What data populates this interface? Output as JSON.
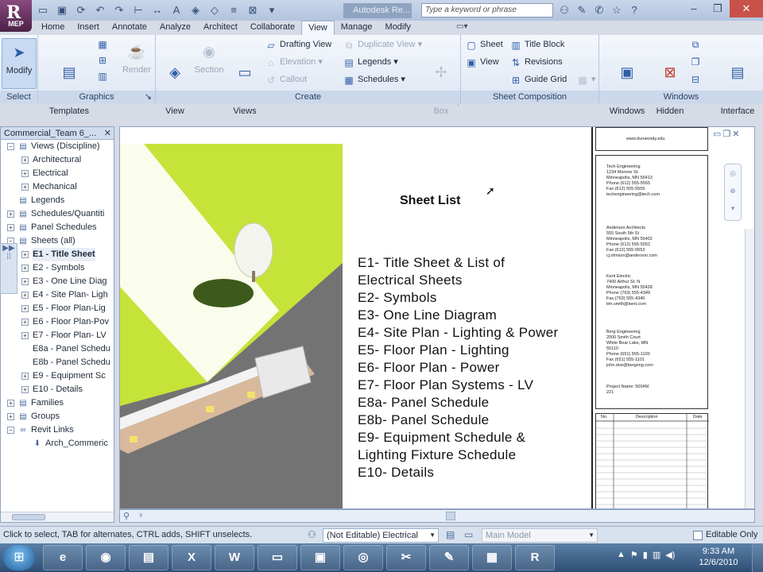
{
  "app": {
    "badge": "MEP",
    "title": "Autodesk Re...",
    "search_placeholder": "Type a keyword or phrase"
  },
  "tabs": [
    "Home",
    "Insert",
    "Annotate",
    "Analyze",
    "Architect",
    "Collaborate",
    "View",
    "Manage",
    "Modify"
  ],
  "active_tab": "View",
  "ribbon": {
    "select": {
      "label": "Select",
      "modify": "Modify"
    },
    "graphics": {
      "label": "Graphics",
      "view_templates": "View\nTemplates",
      "render": "Render"
    },
    "create": {
      "label": "Create",
      "view_3d": "3D\nView",
      "section": "Section",
      "plan_views": "Plan\nViews",
      "drafting_view": "Drafting View",
      "elevation": "Elevation",
      "callout": "Callout",
      "duplicate_view": "Duplicate View",
      "legends": "Legends",
      "schedules": "Schedules",
      "scope_box": "Scope\nBox"
    },
    "sheet_composition": {
      "label": "Sheet Composition",
      "sheet": "Sheet",
      "view": "View",
      "title_block": "Title Block",
      "revisions": "Revisions",
      "guide_grid": "Guide Grid"
    },
    "windows": {
      "label": "Windows",
      "switch_windows": "Switch\nWindows",
      "close_hidden": "Close\nHidden",
      "user_interface": "User\nInterface"
    }
  },
  "browser": {
    "title": "Commercial_Team 6_...",
    "items": [
      {
        "label": "Views (Discipline)",
        "level": 0,
        "toggle": "−",
        "icon": "views-icon"
      },
      {
        "label": "Architectural",
        "level": 1,
        "toggle": "+"
      },
      {
        "label": "Electrical",
        "level": 1,
        "toggle": "+"
      },
      {
        "label": "Mechanical",
        "level": 1,
        "toggle": "+"
      },
      {
        "label": "Legends",
        "level": 0,
        "toggle": "",
        "icon": "legends-icon"
      },
      {
        "label": "Schedules/Quantiti",
        "level": 0,
        "toggle": "+",
        "icon": "schedules-icon"
      },
      {
        "label": "Panel Schedules",
        "level": 0,
        "toggle": "+",
        "icon": "panel-schedules-icon"
      },
      {
        "label": "Sheets (all)",
        "level": 0,
        "toggle": "−",
        "icon": "sheets-icon"
      },
      {
        "label": "E1 - Title Sheet",
        "level": 1,
        "toggle": "+",
        "selected": true
      },
      {
        "label": "E2 - Symbols",
        "level": 1,
        "toggle": "+"
      },
      {
        "label": "E3 - One Line Diag",
        "level": 1,
        "toggle": "+"
      },
      {
        "label": "E4 - Site Plan- Ligh",
        "level": 1,
        "toggle": "+"
      },
      {
        "label": "E5 - Floor Plan-Lig",
        "level": 1,
        "toggle": "+"
      },
      {
        "label": "E6 - Floor Plan-Pov",
        "level": 1,
        "toggle": "+"
      },
      {
        "label": "E7 - Floor Plan- LV",
        "level": 1,
        "toggle": "+"
      },
      {
        "label": "E8a - Panel Schedu",
        "level": 1,
        "toggle": ""
      },
      {
        "label": "E8b - Panel Schedu",
        "level": 1,
        "toggle": ""
      },
      {
        "label": "E9 - Equipment Sc",
        "level": 1,
        "toggle": "+"
      },
      {
        "label": "E10 - Details",
        "level": 1,
        "toggle": "+"
      },
      {
        "label": "Families",
        "level": 0,
        "toggle": "+",
        "icon": "families-icon"
      },
      {
        "label": "Groups",
        "level": 0,
        "toggle": "+",
        "icon": "groups-icon"
      },
      {
        "label": "Revit Links",
        "level": 0,
        "toggle": "−",
        "icon": "revit-links-icon"
      },
      {
        "label": "Arch_Commeric",
        "level": 1,
        "toggle": "",
        "icon": "link-icon"
      }
    ]
  },
  "sheet": {
    "title": "Sheet List",
    "entries": [
      "E1- Title Sheet & List of",
      "Electrical Sheets",
      "E2- Symbols",
      "E3- One Line Diagram",
      "E4- Site Plan - Lighting & Power",
      "E5- Floor Plan - Lighting",
      "E6- Floor Plan - Power",
      "E7- Floor Plan Systems - LV",
      "E8a- Panel Schedule",
      "E8b- Panel Schedule",
      "E9- Equipment Schedule &",
      "Lighting Fixture Schedule",
      "E10- Details"
    ],
    "titleblock": {
      "website": "www.dunwoody.edu",
      "contacts": [
        "Tech Engineering\n1234 Monroe St.\nMinneapolis, MN 55413\nPhone (612) 555-5555\nFax (612) 555-5559\ntechengineering@tech.com",
        "Anderson Architects\n555 South 5th St\nMinneapolis, MN 55402\nPhone (612) 555-5552\nFax (612) 555-5553\ncj.ohnson@anderson.com",
        "Kent Electric\n7400 Arthur St. N\nMinneapolis, MN 55428\nPhone (763) 555-4349\nFax (763) 555-4340\ntim.smith@kent.com",
        "Berg Engineering\n2000 Smith Court\nWhite Bear Lake, MN\n55110\nPhone (651) 555-1100\nFax (651) 555-1101\njohn.doe@bergeng.com",
        "Project Name: 5004M\n221"
      ],
      "rev_headers": [
        "No.",
        "Description",
        "Date"
      ]
    }
  },
  "status": {
    "hint": "Click to select, TAB for alternates, CTRL adds, SHIFT unselects.",
    "workset": "(Not Editable) Electrical",
    "design_option": "Main Model",
    "editable_only": "Editable Only"
  },
  "taskbar": {
    "time": "9:33 AM",
    "date": "12/6/2010",
    "apps": [
      "ie-icon",
      "firefox-icon",
      "explorer-icon",
      "excel-icon",
      "word-icon",
      "folder-icon",
      "monitor-icon",
      "webcam-icon",
      "snipping-icon",
      "paint-icon",
      "calculator-icon",
      "revit-icon"
    ]
  },
  "colors": {
    "grass": "#c6e33a",
    "grass_dark": "#a9c92d",
    "ground": "#737373",
    "building_wall": "#d9b99b",
    "window": "#f1e36a"
  }
}
